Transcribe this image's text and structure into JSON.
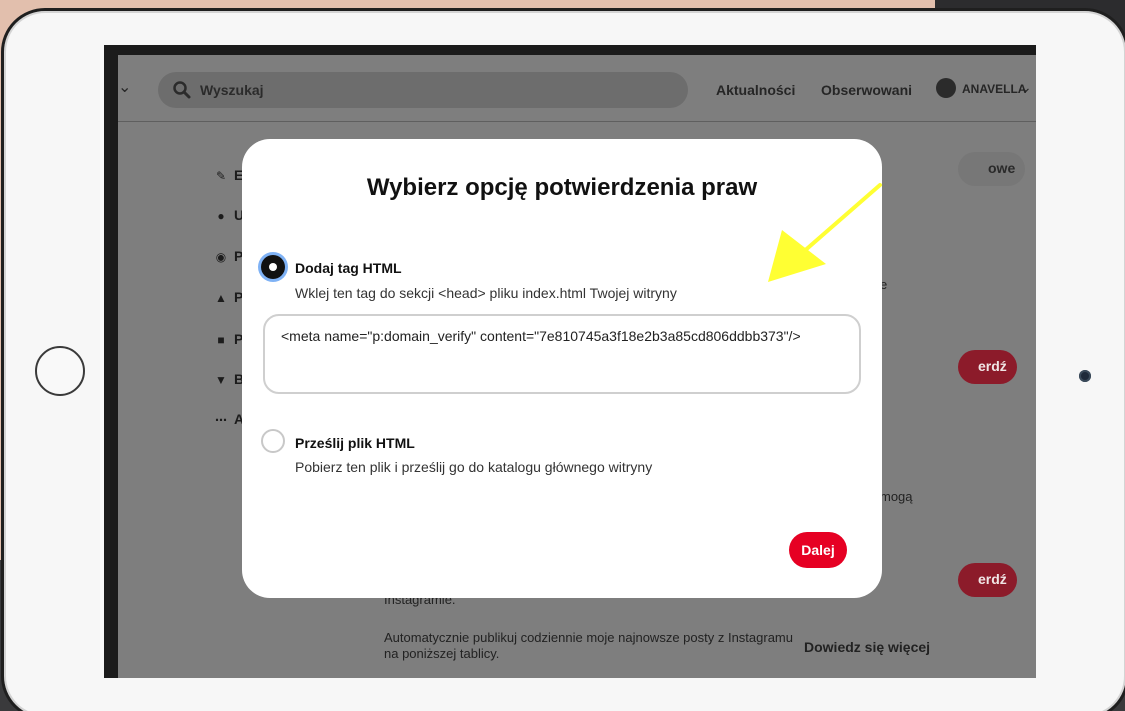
{
  "topbar": {
    "search_placeholder": "Wyszukaj",
    "nav_news": "Aktualności",
    "nav_following": "Obserwowani",
    "user_name": "ANAVELLA"
  },
  "sidebar": {
    "items": [
      {
        "label": "E",
        "icon": "pencil-icon"
      },
      {
        "label": "U",
        "icon": "person-icon"
      },
      {
        "label": "P",
        "icon": "globe-icon"
      },
      {
        "label": "P",
        "icon": "bell-icon"
      },
      {
        "label": "P",
        "icon": "lock-icon"
      },
      {
        "label": "B",
        "icon": "shield-icon"
      },
      {
        "label": "A",
        "icon": "grid-icon"
      }
    ]
  },
  "background": {
    "pill_top_label": "owe",
    "pill_confirm_1": "erdź",
    "pill_confirm_2": "erdź",
    "text_right_1": "e",
    "text_right_2": "mogą",
    "instagram_line": "Instagramie.",
    "autopublish_text": "Automatycznie publikuj codziennie moje najnowsze posty z Instagramu na poniższej tablicy.",
    "learn_more": "Dowiedz się więcej"
  },
  "modal": {
    "title": "Wybierz opcję potwierdzenia praw",
    "option_html_tag_title": "Dodaj tag HTML",
    "option_html_tag_desc": "Wklej ten tag do sekcji <head> pliku index.html Twojej witryny",
    "tag_value": "<meta name=\"p:domain_verify\" content=\"7e810745a3f18e2b3a85cd806ddbb373\"/>",
    "option_upload_title": "Prześlij plik HTML",
    "option_upload_desc": "Pobierz ten plik i prześlij go do katalogu głównego witryny",
    "next_button": "Dalej"
  },
  "colors": {
    "accent": "#e60023",
    "arrow": "#ffff33"
  }
}
